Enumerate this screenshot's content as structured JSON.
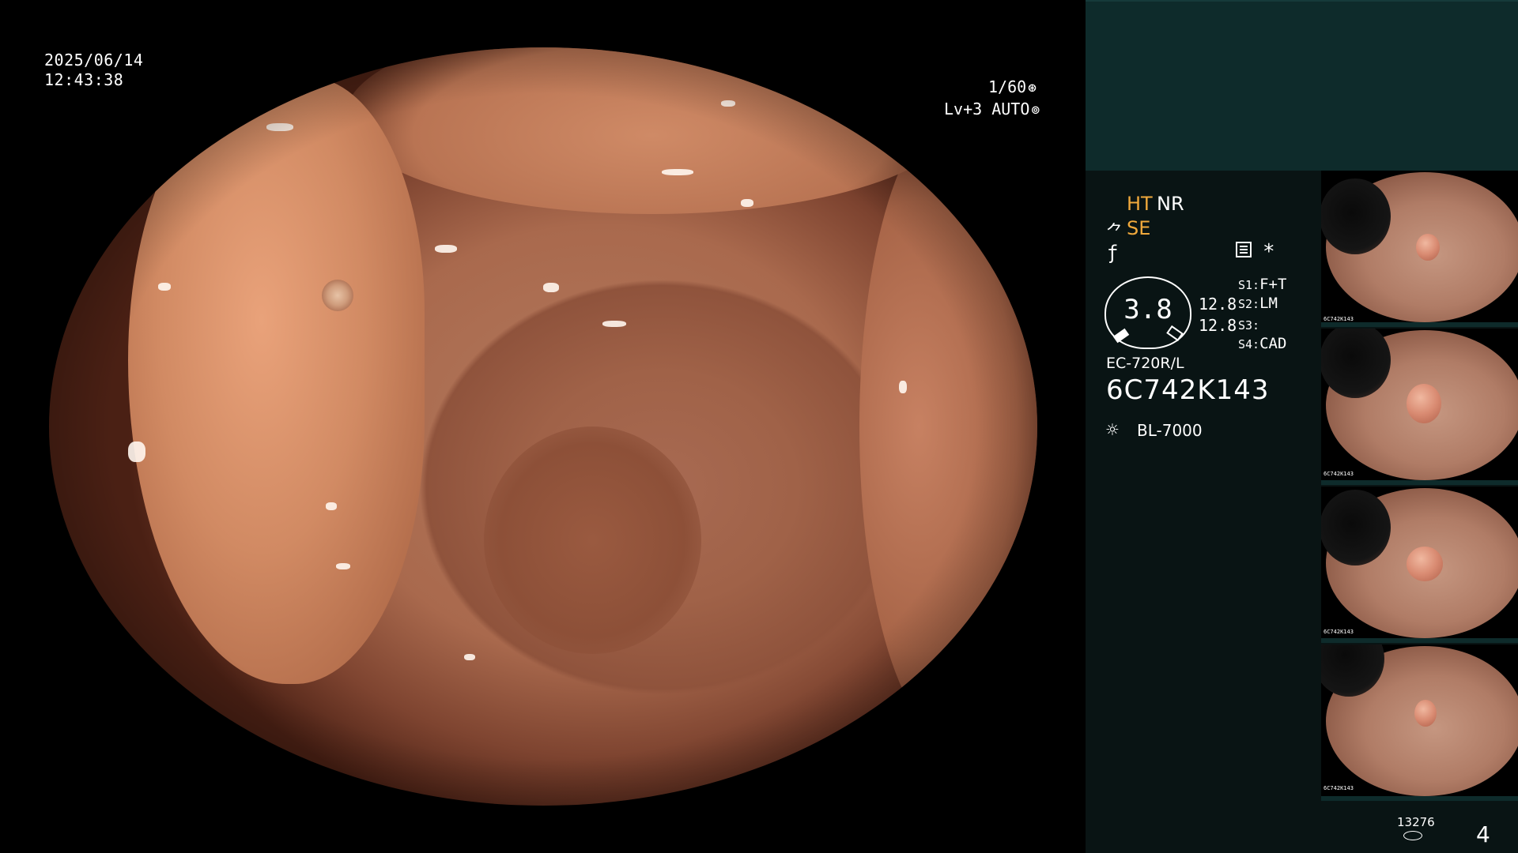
{
  "overlay": {
    "date": "2025/06/14",
    "time": "12:43:38",
    "shutter": "1/60",
    "shutter_icon": "aperture-icon",
    "enhance": "Lv+3 AUTO",
    "enhance_icon": "auto-exposure-icon"
  },
  "panel": {
    "mode_ht": "HT",
    "mode_nr": "NR",
    "mode_se": "SE",
    "se_icon_glyph": "⺈",
    "f_icon_glyph": "ƒ",
    "star_glyph": "*",
    "gauge_value": "3.8",
    "gauge_num_1": "12.8",
    "gauge_num_2": "12.8",
    "switches": [
      {
        "label": "S1:",
        "value": "F+T"
      },
      {
        "label": "S2:",
        "value": "LM"
      },
      {
        "label": "S3:",
        "value": ""
      },
      {
        "label": "S4:",
        "value": "CAD"
      }
    ],
    "scope_model": "EC-720R/L",
    "serial": "6C742K143",
    "light_glyph": "☼",
    "light_source": "BL-7000",
    "image_count": "13276",
    "capture_number": "4",
    "thumb_serial": "6C742K143",
    "colors": {
      "accent": "#f0a93c",
      "panel_top": "#0e2b2b",
      "panel_bg": "#091414"
    }
  }
}
